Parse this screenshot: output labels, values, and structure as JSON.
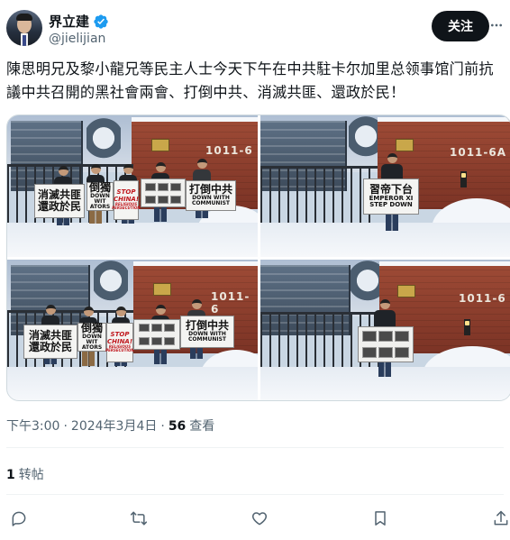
{
  "author": {
    "display_name": "界立建",
    "handle": "@jielijian",
    "verified_color": "#1d9bf0"
  },
  "follow_button_label": "关注",
  "tweet": {
    "text": "陳思明兄及黎小龍兄等民主人士今天下午在中共駐卡尔加里总领事馆门前抗議中共召開的黑社會兩會、打倒中共、消滅共匪、還政於民！",
    "time": "下午3:00",
    "date": "2024年3月4日",
    "views_count": "56",
    "views_label": "查看",
    "reposts_count": "1",
    "reposts_label": "转帖"
  },
  "photos": {
    "address_number": "1011-6",
    "address_suffix": "A",
    "signs": {
      "sign_1_line1": "消滅共匪",
      "sign_1_line2": "還政於民",
      "sign_2_line1": "倒獨",
      "sign_2_line2": "DOWN WIT",
      "sign_2_line3": "ATORS",
      "sign_3_line1": "STOP",
      "sign_3_line2": "CHINA!",
      "sign_3_line3": "RELIGIOUS",
      "sign_3_line4": "PERSECUTION",
      "sign_4_line1": "打倒中共",
      "sign_4_line2": "DOWN WITH",
      "sign_4_line3": "COMMUNIST",
      "sign_5_line1": "習帝下台",
      "sign_5_line2": "EMPEROR XI",
      "sign_5_line3": "STEP DOWN"
    }
  },
  "colors": {
    "text_primary": "#0f1419",
    "text_secondary": "#536471",
    "border": "#cfd9de",
    "follow_bg": "#0f1419"
  },
  "actions": [
    "reply-icon",
    "repost-icon",
    "like-icon",
    "bookmark-icon",
    "share-icon"
  ]
}
